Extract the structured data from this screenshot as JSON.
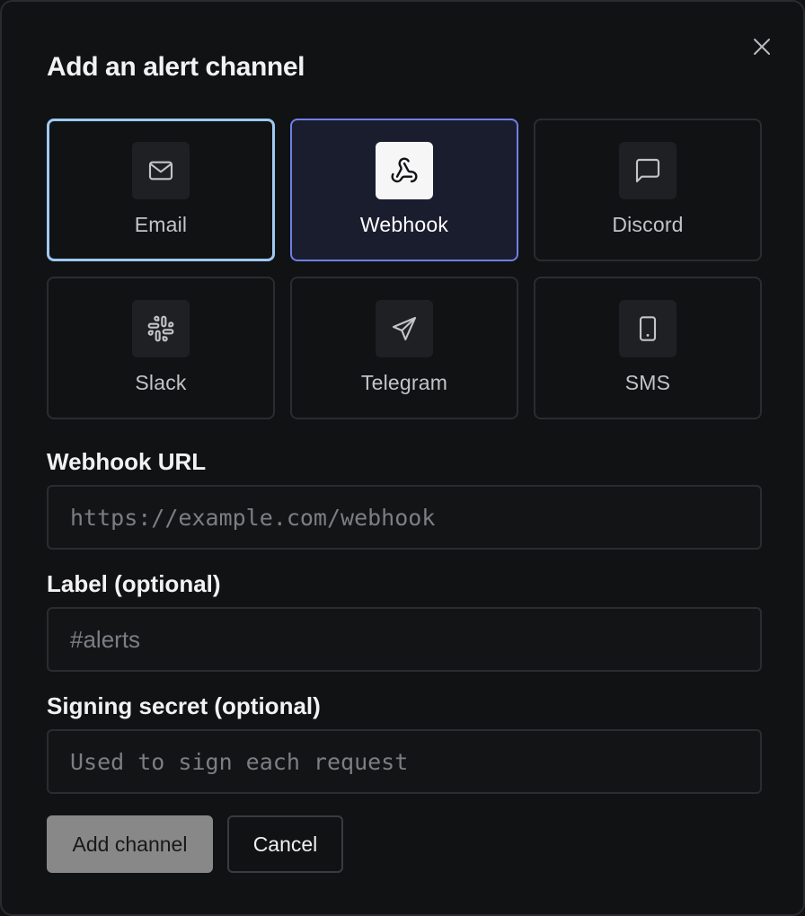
{
  "dialog": {
    "title": "Add an alert channel",
    "close_icon": "close-icon"
  },
  "channels": [
    {
      "label": "Email",
      "icon": "mail-icon",
      "state": "focused"
    },
    {
      "label": "Webhook",
      "icon": "webhook-icon",
      "state": "selected"
    },
    {
      "label": "Discord",
      "icon": "message-square-icon",
      "state": "default"
    },
    {
      "label": "Slack",
      "icon": "slack-icon",
      "state": "default"
    },
    {
      "label": "Telegram",
      "icon": "send-icon",
      "state": "default"
    },
    {
      "label": "SMS",
      "icon": "smartphone-icon",
      "state": "default"
    }
  ],
  "form": {
    "url_label": "Webhook URL",
    "url_placeholder": "https://example.com/webhook",
    "url_value": "",
    "label_label": "Label (optional)",
    "label_placeholder": "#alerts",
    "label_value": "",
    "secret_label": "Signing secret (optional)",
    "secret_placeholder": "Used to sign each request",
    "secret_value": ""
  },
  "actions": {
    "submit_label": "Add channel",
    "cancel_label": "Cancel"
  },
  "colors": {
    "background": "#111214",
    "focus_ring": "#9fc9f2",
    "selected_border": "#6f7fe8",
    "selected_bg": "#1a1d2e",
    "primary_button": "#878887"
  }
}
